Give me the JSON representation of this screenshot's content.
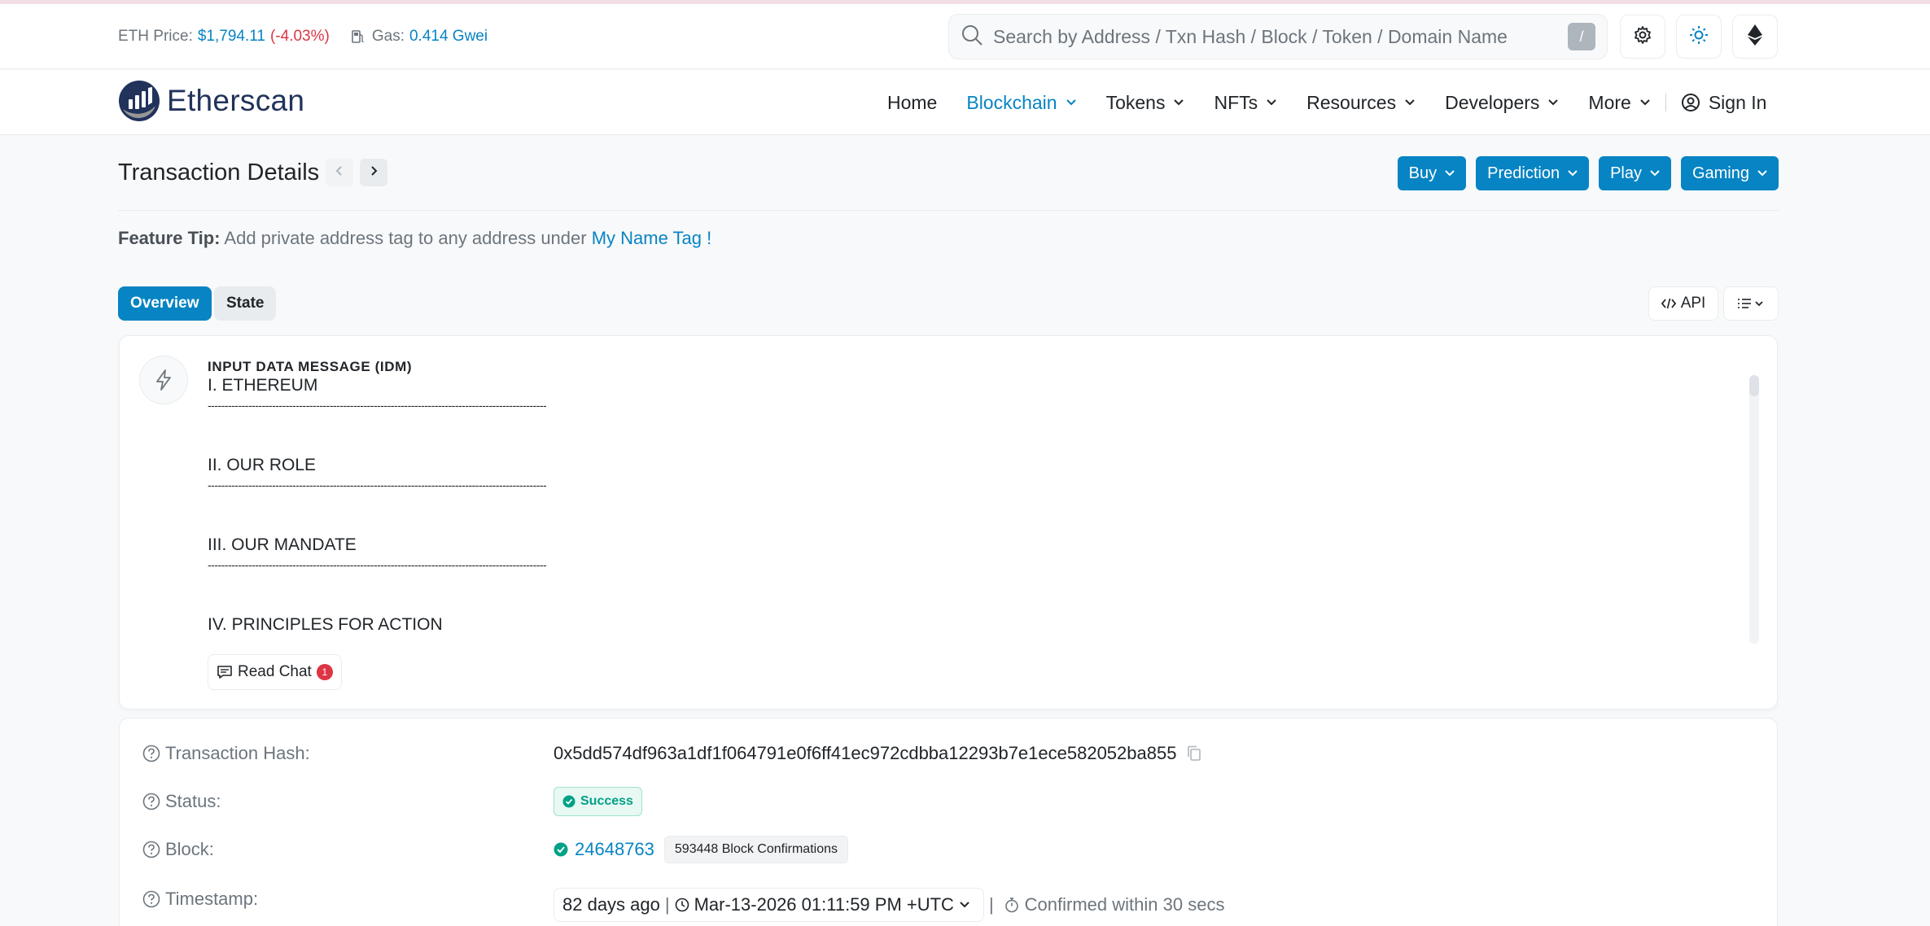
{
  "topbar": {
    "eth_price_label": "ETH Price:",
    "eth_price_value": "$1,794.11",
    "eth_price_change": "(-4.03%)",
    "gas_label": "Gas:",
    "gas_value": "0.414 Gwei",
    "search_placeholder": "Search by Address / Txn Hash / Block / Token / Domain Name",
    "search_shortcut": "/"
  },
  "brand": {
    "name": "Etherscan"
  },
  "nav": {
    "items": [
      {
        "label": "Home"
      },
      {
        "label": "Blockchain"
      },
      {
        "label": "Tokens"
      },
      {
        "label": "NFTs"
      },
      {
        "label": "Resources"
      },
      {
        "label": "Developers"
      },
      {
        "label": "More"
      }
    ],
    "signin": "Sign In"
  },
  "page": {
    "title": "Transaction Details",
    "promo_buttons": [
      "Buy",
      "Prediction",
      "Play",
      "Gaming"
    ],
    "tip_bold": "Feature Tip:",
    "tip_text": " Add private address tag to any address under ",
    "tip_link": "My Name Tag !",
    "tabs": [
      "Overview",
      "State"
    ],
    "api_label": "API"
  },
  "idm": {
    "title": "INPUT DATA MESSAGE (IDM)",
    "sections": [
      {
        "heading": "I. ETHEREUM",
        "rule": "----------------------------------------------------------------------------------------------------"
      },
      {
        "heading": "II. OUR ROLE",
        "rule": "----------------------------------------------------------------------------------------------------"
      },
      {
        "heading": "III. OUR MANDATE",
        "rule": "----------------------------------------------------------------------------------------------------"
      },
      {
        "heading": "IV. PRINCIPLES FOR ACTION",
        "rule": ""
      }
    ],
    "read_chat": "Read Chat",
    "chat_count": "1"
  },
  "details": {
    "hash_label": "Transaction Hash:",
    "hash_value": "0x5dd574df963a1df1f064791e0f6ff41ec972cdbba12293b7e1ece582052ba855",
    "status_label": "Status:",
    "status_value": "Success",
    "block_label": "Block:",
    "block_value": "24648763",
    "block_confirmations": "593448 Block Confirmations",
    "timestamp_label": "Timestamp:",
    "timestamp_ago": "82 days ago",
    "timestamp_value": "Mar-13-2026 01:11:59 PM +UTC",
    "confirmed_text": "Confirmed within 30 secs"
  }
}
